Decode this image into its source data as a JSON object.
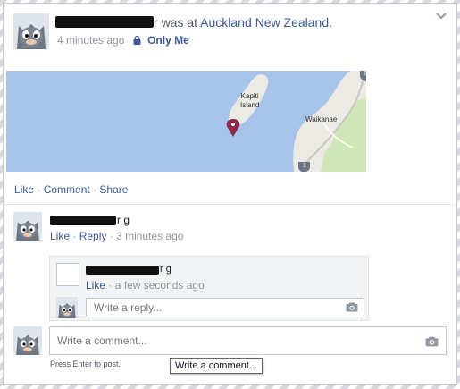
{
  "post": {
    "name_suffix": "r",
    "action_text": "was at",
    "place": "Auckland New Zealand",
    "period": ".",
    "time": "4 minutes ago",
    "privacy": "Only Me"
  },
  "map": {
    "labels": {
      "island": "Kapiti\nIsland",
      "town": "Waikanae",
      "route_top": "1",
      "route_bottom": "1"
    }
  },
  "actions": {
    "like": "Like",
    "comment": "Comment",
    "share": "Share",
    "dot": "·"
  },
  "comment1": {
    "name_suffix": "r g",
    "like": "Like",
    "reply": "Reply",
    "time": "3 minutes ago"
  },
  "reply1": {
    "name_suffix": "r g",
    "like": "Like",
    "time": "a few seconds ago",
    "reply_placeholder": "Write a reply..."
  },
  "composer": {
    "placeholder": "Write a comment...",
    "hint": "Press Enter to post.",
    "tooltip": "Write a comment..."
  },
  "colors": {
    "link": "#3b5998",
    "map_water": "#a8c3ea",
    "map_land": "#eceae4",
    "map_park": "#cfe6b8",
    "pin": "#8e2a45"
  }
}
